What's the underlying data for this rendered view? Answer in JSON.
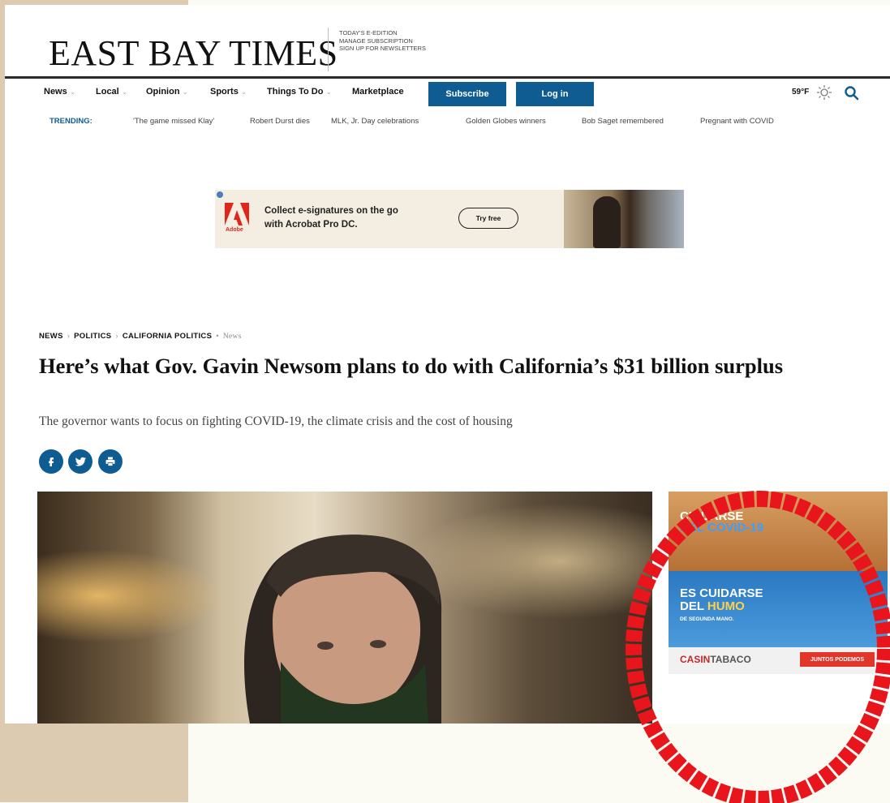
{
  "masthead": {
    "logo": "EAST BAY TIMES",
    "links": [
      "TODAY'S E-EDITION",
      "MANAGE SUBSCRIPTION",
      "SIGN UP FOR NEWSLETTERS"
    ]
  },
  "nav": {
    "items": [
      "News",
      "Local",
      "Opinion",
      "Sports",
      "Things To Do",
      "Marketplace"
    ],
    "subscribe": "Subscribe",
    "login": "Log in",
    "weather": "59°F"
  },
  "trending": {
    "label": "TRENDING:",
    "items": [
      "'The game missed Klay'",
      "Robert Durst dies",
      "MLK, Jr. Day celebrations",
      "Golden Globes winners",
      "Bob Saget remembered",
      "Pregnant with COVID"
    ]
  },
  "ad": {
    "brand": "Adobe",
    "line1": "Collect e-signatures on the go",
    "line2": "with Acrobat Pro DC.",
    "cta": "Try free"
  },
  "article": {
    "breadcrumb": [
      "NEWS",
      "POLITICS",
      "CALIFORNIA POLITICS"
    ],
    "tag": "News",
    "headline": "Here’s what Gov. Gavin Newsom plans to do with California’s $31 billion surplus",
    "subhead": "The governor wants to focus on fighting COVID-19, the climate crisis and the cost of housing"
  },
  "side_ad": {
    "title1_a": "CUIDARSE",
    "title1_b": "DEL COVID-19",
    "title2_a": "ES CUIDARSE",
    "title2_b_white": "DEL ",
    "title2_b_yellow": "HUMO",
    "title2_c": "DE SEGUNDA MANO.",
    "brand_a": "CASIN",
    "brand_b": "TABACO",
    "cta": "JUNTOS PODEMOS"
  },
  "colors": {
    "brand_blue": "#0f5c93",
    "annotation_red": "#e8161c",
    "frame_tan": "#dccbb0"
  }
}
